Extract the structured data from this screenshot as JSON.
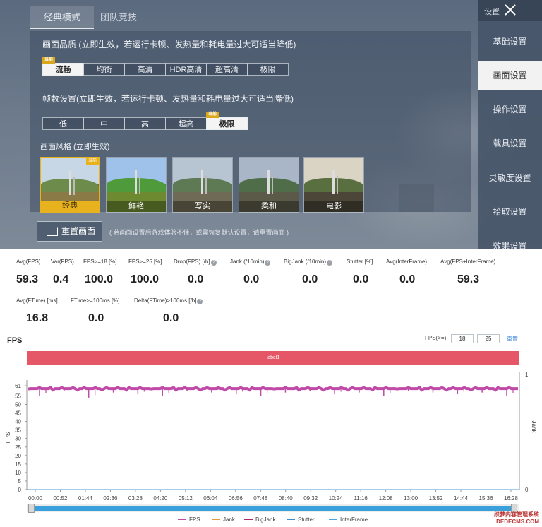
{
  "game": {
    "tabs": [
      "经典模式",
      "团队竞技"
    ],
    "quality": {
      "title": "画面品质 (立即生效，若运行卡顿、发热量和耗电量过大可适当降低)",
      "options": [
        "流畅",
        "均衡",
        "高清",
        "HDR高清",
        "超高清",
        "极限"
      ],
      "selected": "流畅",
      "current_tag": "当前"
    },
    "framerate": {
      "title": "帧数设置(立即生效，若运行卡顿、发热量和耗电量过大可适当降低)",
      "options": [
        "低",
        "中",
        "高",
        "超高",
        "极限"
      ],
      "selected": "极限",
      "current_tag": "当前"
    },
    "style": {
      "title": "画面风格 (立即生效)",
      "options": [
        "经典",
        "鲜艳",
        "写实",
        "柔和",
        "电影"
      ],
      "selected": "经典",
      "current_tag": "当前"
    },
    "reset_button": "重置画面",
    "reset_hint": "( 若画面设置后游戏体验不佳，或需恢复默认设置，请重置画面 )",
    "sidebar": {
      "top_label": "设置",
      "items": [
        "基础设置",
        "画面设置",
        "操作设置",
        "载具设置",
        "灵敏度设置",
        "拾取设置",
        "效果设置"
      ],
      "selected": "画面设置"
    }
  },
  "stats": {
    "row1": [
      {
        "label": "Avg(FPS)",
        "value": "59.3",
        "help": false
      },
      {
        "label": "Var(FPS)",
        "value": "0.4",
        "help": false
      },
      {
        "label": "FPS>=18 [%]",
        "value": "100.0",
        "help": false
      },
      {
        "label": "FPS>=25 [%]",
        "value": "100.0",
        "help": false
      },
      {
        "label": "Drop(FPS) [/h]",
        "value": "0.0",
        "help": true
      },
      {
        "label": "Jank (/10min)",
        "value": "0.0",
        "help": true
      },
      {
        "label": "BigJank (/10min)",
        "value": "0.0",
        "help": true
      },
      {
        "label": "Stutter [%]",
        "value": "0.0",
        "help": false
      },
      {
        "label": "Avg(InterFrame)",
        "value": "0.0",
        "help": false
      },
      {
        "label": "Avg(FPS+InterFrame)",
        "value": "59.3",
        "help": false
      }
    ],
    "row2": [
      {
        "label": "Avg(FTime) [ms]",
        "value": "16.8",
        "help": false
      },
      {
        "label": "FTime>=100ms [%]",
        "value": "0.0",
        "help": false
      },
      {
        "label": "Delta(FTime)>100ms [/h]",
        "value": "0.0",
        "help": true
      }
    ],
    "help_glyph": "?"
  },
  "fps_panel": {
    "heading": "FPS",
    "threshold_label": "FPS(>=)",
    "threshold_1": "18",
    "threshold_2": "25",
    "reset_link": "重置",
    "label_bar": "label1"
  },
  "chart_data": {
    "type": "line",
    "ylabel": "FPS",
    "y2label": "Jank",
    "yticks": [
      0,
      5,
      10,
      15,
      20,
      25,
      30,
      35,
      40,
      45,
      50,
      55,
      61
    ],
    "ylim": [
      0,
      61
    ],
    "y2ticks": [
      0,
      1
    ],
    "x": [
      "00:00",
      "00:52",
      "01:44",
      "02:36",
      "03:28",
      "04:20",
      "05:12",
      "06:04",
      "06:56",
      "07:48",
      "08:40",
      "09:32",
      "10:24",
      "11:16",
      "12:08",
      "13:00",
      "13:52",
      "14:44",
      "15:36",
      "16:28"
    ],
    "series": [
      {
        "name": "FPS",
        "color": "#c04aa8",
        "baseline": 59.3,
        "dips": [
          55,
          58,
          54,
          57,
          56,
          55,
          58,
          57,
          56,
          55,
          57,
          58,
          56,
          57,
          55,
          58,
          57,
          56,
          57,
          55
        ]
      },
      {
        "name": "Jank",
        "color": "#e09a3c",
        "values": [
          0
        ]
      },
      {
        "name": "BigJank",
        "color": "#a8286a",
        "values": [
          0
        ]
      },
      {
        "name": "Stutter",
        "color": "#3a8fd0",
        "values": [
          0
        ]
      },
      {
        "name": "InterFrame",
        "color": "#4aa3df",
        "values": [
          0
        ]
      }
    ]
  },
  "watermark": {
    "line1": "织梦内容管理系统",
    "line2": "DEDECMS.COM"
  }
}
